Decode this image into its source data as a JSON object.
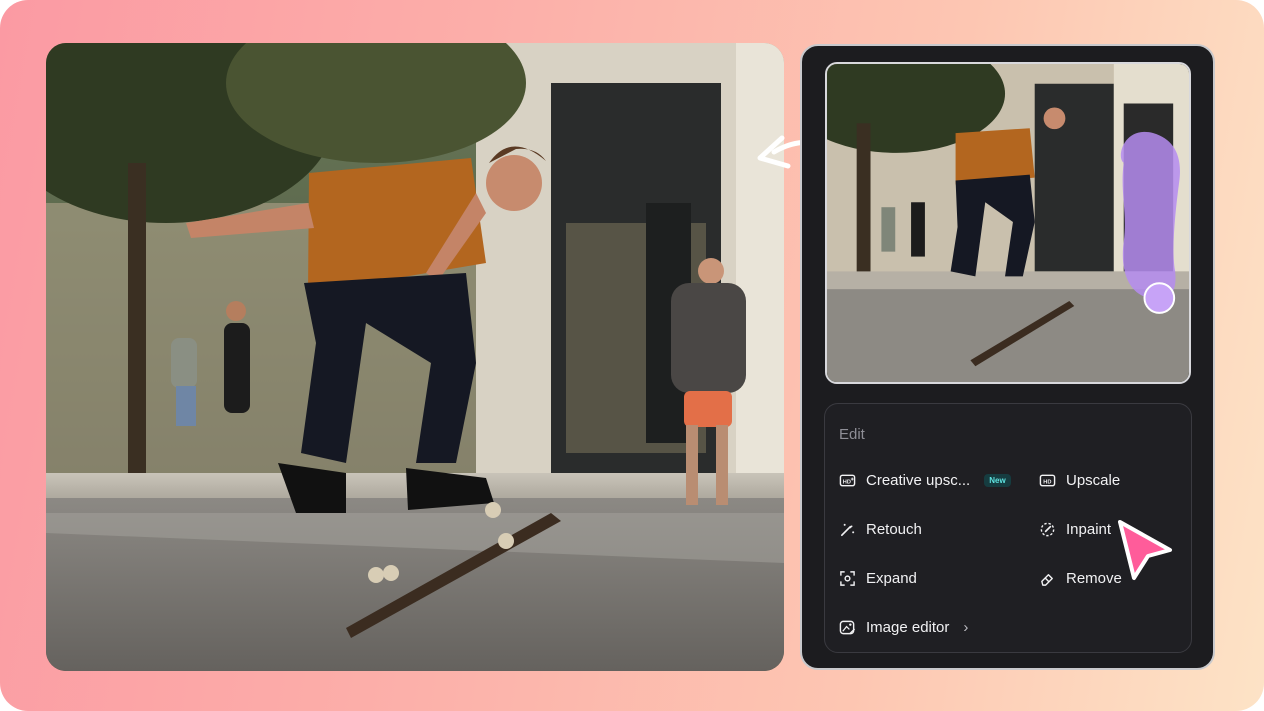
{
  "edit_panel": {
    "heading": "Edit",
    "tools": {
      "creative_upscale": {
        "label": "Creative upsc...",
        "badge": "New",
        "icon": "hd-plus-icon"
      },
      "upscale": {
        "label": "Upscale",
        "icon": "hd-icon"
      },
      "retouch": {
        "label": "Retouch",
        "icon": "magic-wand-icon"
      },
      "inpaint": {
        "label": "Inpaint",
        "icon": "inpaint-brush-icon"
      },
      "expand": {
        "label": "Expand",
        "icon": "expand-frame-icon"
      },
      "remove": {
        "label": "Remove",
        "icon": "eraser-icon"
      },
      "image_editor": {
        "label": "Image editor",
        "icon": "image-edit-icon",
        "chevron": "›"
      }
    }
  },
  "colors": {
    "background_gradient": [
      "#fb9aa3",
      "#fde3c6"
    ],
    "panel": "#1c1c1f",
    "inpaint_mask": "#b58cf0",
    "pointer": "#ff5c9a",
    "new_badge": "#5fe3e0"
  }
}
